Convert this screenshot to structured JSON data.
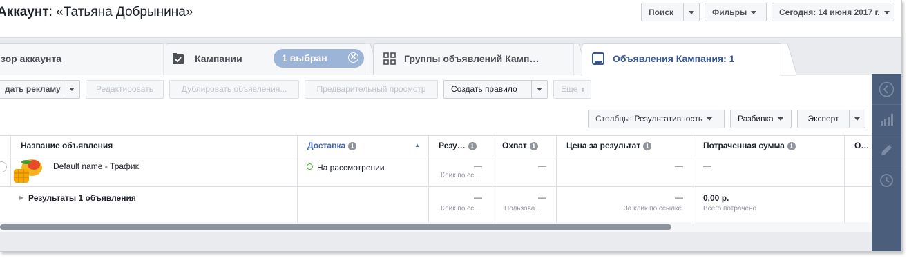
{
  "header": {
    "title_bold": "Аккаунт",
    "title_rest": ": «Татьяна Добрынина»",
    "search_label": "Поиск",
    "filters_label": "Фильры",
    "date_label": "Сегодня: 14 июня 2017 г."
  },
  "tabs": {
    "overview": "зор аккаунта",
    "campaigns": "Кампании",
    "selected_pill": "1 выбран",
    "adsets": "Группы объявлений Камп…",
    "ads": "Объявления Кампания: 1"
  },
  "toolbar": {
    "create_ad": "дать рекламу",
    "edit": "Редактировать",
    "duplicate": "Дублировать объявления...",
    "preview": "Предварительный просмотр",
    "create_rule": "Создать правило",
    "more": "Еще",
    "columns_prefix": "Столбцы: ",
    "columns_value": "Результативность",
    "breakdown": "Разбивка",
    "export": "Экспорт"
  },
  "table": {
    "columns": {
      "name": "Название объявления",
      "delivery": "Доставка",
      "results": "Резу…",
      "reach": "Охват",
      "cost_per_result": "Цена за результат",
      "amount_spent": "Потраченная сумма",
      "other": "О…"
    },
    "row": {
      "name": "Default name - Трафик",
      "delivery": "На рассмотрении",
      "results": "—",
      "results_sub": "Клик по сс…",
      "reach": "—",
      "cost": "—",
      "spent": "—"
    },
    "summary": {
      "label": "Результаты 1 объявления",
      "results": "—",
      "results_sub": "Клик по сс…",
      "reach": "—",
      "reach_sub": "Пользова…",
      "cost": "—",
      "cost_sub": "За клик по ссылке",
      "spent": "0,00 р.",
      "spent_sub": "Всего потрачено"
    }
  },
  "colors": {
    "accent": "#4267b2",
    "active_tab_text": "#365899",
    "pill_bg": "#9cb4d8",
    "rail_bg": "#4b5f7d",
    "status_dot": "#42b72a"
  },
  "icons": [
    "checkbox-icon",
    "grid-icon",
    "ads-icon",
    "close-circle-icon",
    "info-icon",
    "sort-up-icon",
    "collapse-left-icon",
    "bar-chart-icon",
    "pencil-icon",
    "clock-icon",
    "expand-triangle-icon"
  ]
}
